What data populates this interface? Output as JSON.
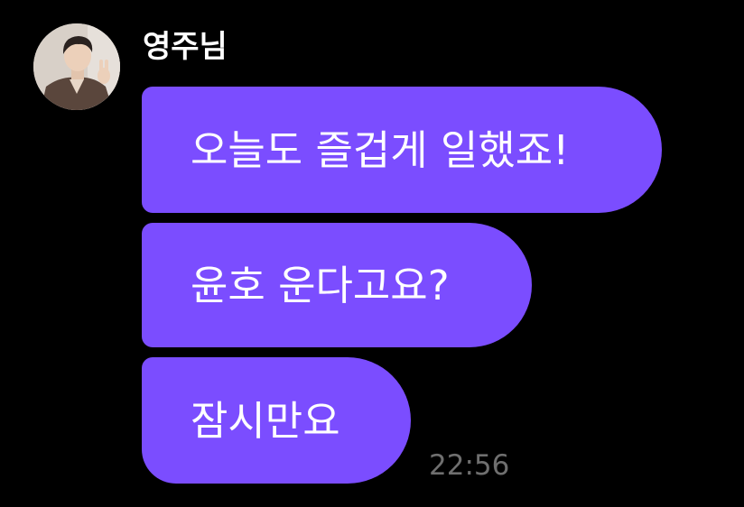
{
  "chat": {
    "sender": {
      "name": "영주님",
      "avatar_icon": "profile-photo"
    },
    "messages": [
      {
        "text": "오늘도 즐겁게 일했죠!"
      },
      {
        "text": "윤호 운다고요?"
      },
      {
        "text": "잠시만요"
      }
    ],
    "timestamp": "22:56",
    "colors": {
      "background": "#000000",
      "bubble": "#7b4dff",
      "bubble_text": "#ffffff",
      "timestamp": "#6f6f6f"
    }
  }
}
